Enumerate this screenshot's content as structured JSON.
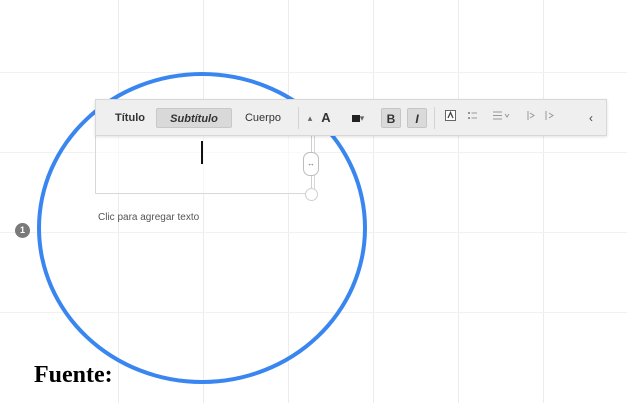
{
  "toolbar": {
    "style_tabs": [
      "Título",
      "Subtítulo",
      "Cuerpo"
    ],
    "active_style": "Subtítulo",
    "font_size_decrease": "▴",
    "font_size_label": "A",
    "color_dropdown": "▾",
    "bold_label": "B",
    "italic_label": "I",
    "more": "‹"
  },
  "canvas": {
    "placeholder": "Clic para agregar texto",
    "step_badge": "1",
    "resize_handle_glyph": "↔"
  },
  "caption": "Fuente:",
  "colors": {
    "circle": "#3a86f0",
    "toolbar_bg": "#efefef"
  },
  "icons": [
    "text-color-icon",
    "bullet-list-icon",
    "align-icon",
    "indent-decrease-icon",
    "indent-increase-icon"
  ]
}
